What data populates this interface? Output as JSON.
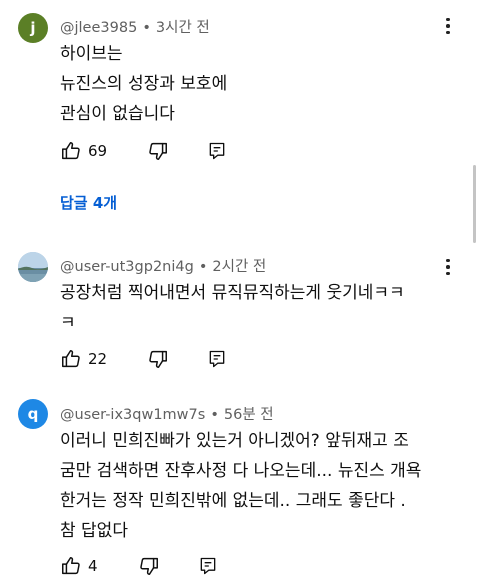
{
  "comments": [
    {
      "avatar_letter": "j",
      "avatar_color": "#5b7f26",
      "username": "@jlee3985",
      "time": "3시간 전",
      "lines": [
        "하이브는",
        "뉴진스의 성장과 보호에",
        "관심이 없습니다"
      ],
      "likes": "69",
      "replies_label": "답글 4개"
    },
    {
      "avatar_type": "photo",
      "username": "@user-ut3gp2ni4g",
      "time": "2시간 전",
      "lines": [
        "공장처럼 찍어내면서 뮤직뮤직하는게 웃기네ㅋㅋ",
        "ㅋ"
      ],
      "likes": "22"
    },
    {
      "avatar_letter": "q",
      "avatar_color": "#1e88e5",
      "username": "@user-ix3qw1mw7s",
      "time": "56분 전",
      "lines": [
        "이러니 민희진빠가 있는거 아니겠어? 앞뒤재고 조",
        "굼만 검색하면 잔후사정 다 나오는데... 뉴진스 개욕",
        "한거는 정작 민희진밖에 없는데.. 그래도 좋단다 .",
        "참 답없다"
      ],
      "likes": "4"
    }
  ],
  "icons": {
    "like": "thumbs-up-icon",
    "dislike": "thumbs-down-icon",
    "reply": "reply-icon",
    "menu": "more-vert-icon"
  },
  "colors": {
    "link": "#065fd4",
    "meta": "#606060"
  }
}
